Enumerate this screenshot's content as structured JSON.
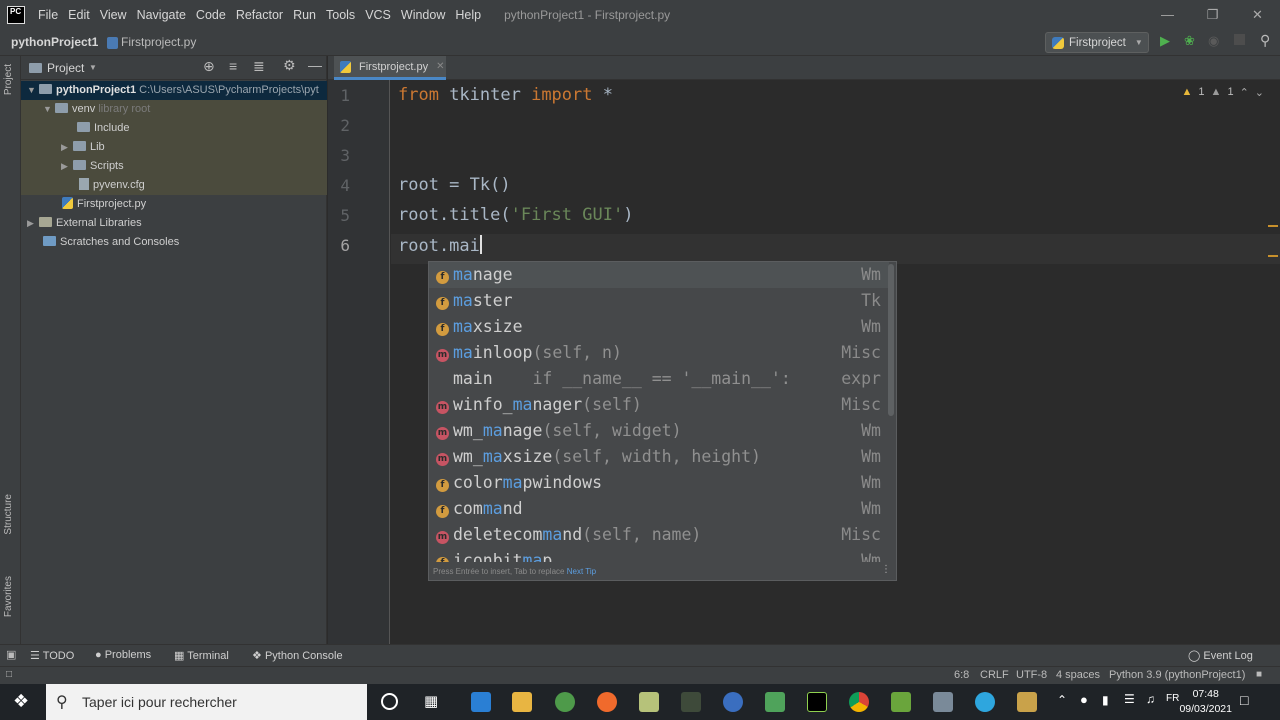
{
  "window": {
    "title": "pythonProject1 - Firstproject.py",
    "menu": [
      "File",
      "Edit",
      "View",
      "Navigate",
      "Code",
      "Refactor",
      "Run",
      "Tools",
      "VCS",
      "Window",
      "Help"
    ],
    "logo": "PC"
  },
  "navbar": {
    "project": "pythonProject1",
    "file": "Firstproject.py",
    "run_config": "Firstproject"
  },
  "side_strip": {
    "project": "Project",
    "structure": "Structure",
    "favorites": "Favorites"
  },
  "project_panel": {
    "title": "Project",
    "tree": {
      "root_name": "pythonProject1",
      "root_path": "C:\\Users\\ASUS\\PycharmProjects\\pyt",
      "venv": "venv",
      "venv_note": "library root",
      "include": "Include",
      "lib": "Lib",
      "scripts": "Scripts",
      "cfg": "pyvenv.cfg",
      "file": "Firstproject.py",
      "ext_libs": "External Libraries",
      "scratches": "Scratches and Consoles"
    }
  },
  "editor": {
    "tab": "Firstproject.py",
    "inspections": {
      "warnings": "1",
      "weak": "1"
    },
    "line_numbers": [
      "1",
      "2",
      "3",
      "4",
      "5",
      "6"
    ],
    "lines": {
      "l1_kw1": "from",
      "l1_mod": " tkinter ",
      "l1_kw2": "import",
      "l1_rest": " *",
      "l4": "root = Tk()",
      "l5_a": "root.title(",
      "l5_str": "'First GUI'",
      "l5_b": ")",
      "l6": "root.mai"
    }
  },
  "completion": {
    "items": [
      {
        "badge": "f",
        "match": "ma",
        "rest": "nage",
        "sig": "",
        "type": "Wm"
      },
      {
        "badge": "f",
        "match": "ma",
        "rest": "ster",
        "sig": "",
        "type": "Tk"
      },
      {
        "badge": "f",
        "match": "ma",
        "rest": "xsize",
        "sig": "",
        "type": "Wm"
      },
      {
        "badge": "m",
        "match": "ma",
        "rest": "inloop",
        "sig": "(self, n)",
        "type": "Misc"
      },
      {
        "badge": "",
        "pre": "main",
        "sig": "    if __name__ == '__main__':",
        "type": "expr"
      },
      {
        "badge": "m",
        "pre": "winfo_",
        "match": "ma",
        "rest": "nager",
        "sig": "(self)",
        "type": "Misc"
      },
      {
        "badge": "m",
        "pre": "wm_",
        "match": "ma",
        "rest": "nage",
        "sig": "(self, widget)",
        "type": "Wm"
      },
      {
        "badge": "m",
        "pre": "wm_",
        "match": "ma",
        "rest": "xsize",
        "sig": "(self, width, height)",
        "type": "Wm"
      },
      {
        "badge": "f",
        "pre": "color",
        "match": "ma",
        "rest": "pwindows",
        "sig": "",
        "type": "Wm"
      },
      {
        "badge": "f",
        "pre": "com",
        "match": "ma",
        "rest": "nd",
        "sig": "",
        "type": "Wm"
      },
      {
        "badge": "m",
        "pre": "deletecom",
        "match": "ma",
        "rest": "nd",
        "sig": "(self, name)",
        "type": "Misc"
      },
      {
        "badge": "f",
        "pre": "iconbit",
        "match": "ma",
        "rest": "p",
        "sig": "",
        "type": "Wm"
      }
    ],
    "tip": "Press Entrée to insert, Tab to replace",
    "tip_link": "Next Tip"
  },
  "bottom_tools": {
    "todo": "TODO",
    "problems": "Problems",
    "terminal": "Terminal",
    "console": "Python Console",
    "event_log": "Event Log"
  },
  "status": {
    "position": "6:8",
    "line_sep": "CRLF",
    "encoding": "UTF-8",
    "indent": "4 spaces",
    "interpreter": "Python 3.9 (pythonProject1)"
  },
  "taskbar": {
    "search_placeholder": "Taper ici pour rechercher",
    "time": "07:48",
    "date": "09/03/2021"
  },
  "colors": {
    "accent": "#4a88c7",
    "keyword": "#cc7832",
    "string": "#6a8759",
    "match": "#5c9ee0"
  }
}
